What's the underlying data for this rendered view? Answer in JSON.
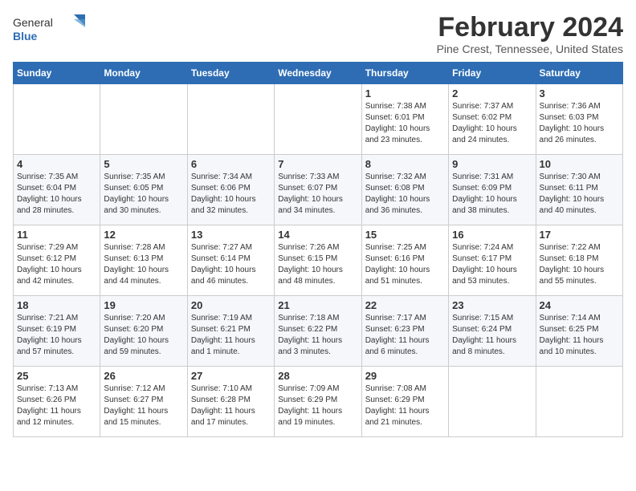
{
  "logo": {
    "text_general": "General",
    "text_blue": "Blue"
  },
  "title": "February 2024",
  "subtitle": "Pine Crest, Tennessee, United States",
  "weekdays": [
    "Sunday",
    "Monday",
    "Tuesday",
    "Wednesday",
    "Thursday",
    "Friday",
    "Saturday"
  ],
  "weeks": [
    [
      {
        "day": "",
        "info": ""
      },
      {
        "day": "",
        "info": ""
      },
      {
        "day": "",
        "info": ""
      },
      {
        "day": "",
        "info": ""
      },
      {
        "day": "1",
        "info": "Sunrise: 7:38 AM\nSunset: 6:01 PM\nDaylight: 10 hours\nand 23 minutes."
      },
      {
        "day": "2",
        "info": "Sunrise: 7:37 AM\nSunset: 6:02 PM\nDaylight: 10 hours\nand 24 minutes."
      },
      {
        "day": "3",
        "info": "Sunrise: 7:36 AM\nSunset: 6:03 PM\nDaylight: 10 hours\nand 26 minutes."
      }
    ],
    [
      {
        "day": "4",
        "info": "Sunrise: 7:35 AM\nSunset: 6:04 PM\nDaylight: 10 hours\nand 28 minutes."
      },
      {
        "day": "5",
        "info": "Sunrise: 7:35 AM\nSunset: 6:05 PM\nDaylight: 10 hours\nand 30 minutes."
      },
      {
        "day": "6",
        "info": "Sunrise: 7:34 AM\nSunset: 6:06 PM\nDaylight: 10 hours\nand 32 minutes."
      },
      {
        "day": "7",
        "info": "Sunrise: 7:33 AM\nSunset: 6:07 PM\nDaylight: 10 hours\nand 34 minutes."
      },
      {
        "day": "8",
        "info": "Sunrise: 7:32 AM\nSunset: 6:08 PM\nDaylight: 10 hours\nand 36 minutes."
      },
      {
        "day": "9",
        "info": "Sunrise: 7:31 AM\nSunset: 6:09 PM\nDaylight: 10 hours\nand 38 minutes."
      },
      {
        "day": "10",
        "info": "Sunrise: 7:30 AM\nSunset: 6:11 PM\nDaylight: 10 hours\nand 40 minutes."
      }
    ],
    [
      {
        "day": "11",
        "info": "Sunrise: 7:29 AM\nSunset: 6:12 PM\nDaylight: 10 hours\nand 42 minutes."
      },
      {
        "day": "12",
        "info": "Sunrise: 7:28 AM\nSunset: 6:13 PM\nDaylight: 10 hours\nand 44 minutes."
      },
      {
        "day": "13",
        "info": "Sunrise: 7:27 AM\nSunset: 6:14 PM\nDaylight: 10 hours\nand 46 minutes."
      },
      {
        "day": "14",
        "info": "Sunrise: 7:26 AM\nSunset: 6:15 PM\nDaylight: 10 hours\nand 48 minutes."
      },
      {
        "day": "15",
        "info": "Sunrise: 7:25 AM\nSunset: 6:16 PM\nDaylight: 10 hours\nand 51 minutes."
      },
      {
        "day": "16",
        "info": "Sunrise: 7:24 AM\nSunset: 6:17 PM\nDaylight: 10 hours\nand 53 minutes."
      },
      {
        "day": "17",
        "info": "Sunrise: 7:22 AM\nSunset: 6:18 PM\nDaylight: 10 hours\nand 55 minutes."
      }
    ],
    [
      {
        "day": "18",
        "info": "Sunrise: 7:21 AM\nSunset: 6:19 PM\nDaylight: 10 hours\nand 57 minutes."
      },
      {
        "day": "19",
        "info": "Sunrise: 7:20 AM\nSunset: 6:20 PM\nDaylight: 10 hours\nand 59 minutes."
      },
      {
        "day": "20",
        "info": "Sunrise: 7:19 AM\nSunset: 6:21 PM\nDaylight: 11 hours\nand 1 minute."
      },
      {
        "day": "21",
        "info": "Sunrise: 7:18 AM\nSunset: 6:22 PM\nDaylight: 11 hours\nand 3 minutes."
      },
      {
        "day": "22",
        "info": "Sunrise: 7:17 AM\nSunset: 6:23 PM\nDaylight: 11 hours\nand 6 minutes."
      },
      {
        "day": "23",
        "info": "Sunrise: 7:15 AM\nSunset: 6:24 PM\nDaylight: 11 hours\nand 8 minutes."
      },
      {
        "day": "24",
        "info": "Sunrise: 7:14 AM\nSunset: 6:25 PM\nDaylight: 11 hours\nand 10 minutes."
      }
    ],
    [
      {
        "day": "25",
        "info": "Sunrise: 7:13 AM\nSunset: 6:26 PM\nDaylight: 11 hours\nand 12 minutes."
      },
      {
        "day": "26",
        "info": "Sunrise: 7:12 AM\nSunset: 6:27 PM\nDaylight: 11 hours\nand 15 minutes."
      },
      {
        "day": "27",
        "info": "Sunrise: 7:10 AM\nSunset: 6:28 PM\nDaylight: 11 hours\nand 17 minutes."
      },
      {
        "day": "28",
        "info": "Sunrise: 7:09 AM\nSunset: 6:29 PM\nDaylight: 11 hours\nand 19 minutes."
      },
      {
        "day": "29",
        "info": "Sunrise: 7:08 AM\nSunset: 6:29 PM\nDaylight: 11 hours\nand 21 minutes."
      },
      {
        "day": "",
        "info": ""
      },
      {
        "day": "",
        "info": ""
      }
    ]
  ]
}
